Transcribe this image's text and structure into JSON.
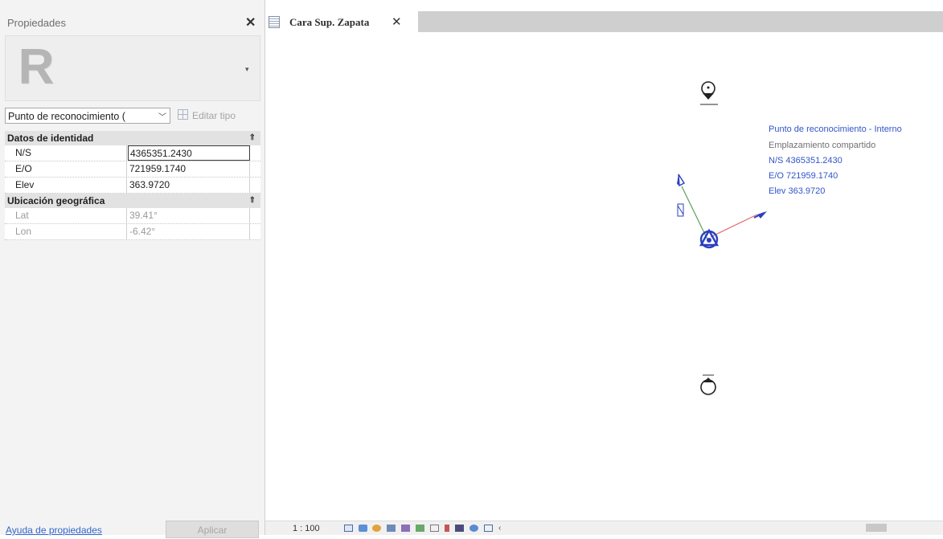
{
  "properties_panel": {
    "title": "Propiedades",
    "close_icon": "close-icon",
    "logo_letter": "R",
    "type_selector": "Punto de reconocimiento (",
    "edit_type_label": "Editar tipo",
    "groups": [
      {
        "name": "Datos de identidad",
        "rows": [
          {
            "name": "N/S",
            "value": "4365351.2430"
          },
          {
            "name": "E/O",
            "value": "721959.1740"
          },
          {
            "name": "Elev",
            "value": "363.9720"
          }
        ]
      },
      {
        "name": "Ubicación geográfica",
        "rows": [
          {
            "name": "Lat",
            "value": "39.41°"
          },
          {
            "name": "Lon",
            "value": "-6.42°"
          }
        ]
      }
    ],
    "help_link": "Ayuda de propiedades",
    "apply_button": "Aplicar"
  },
  "view_tab": {
    "label": "Cara Sup. Zapata",
    "icon": "floor-plan-view-icon",
    "close_icon": "close-icon"
  },
  "canvas": {
    "annotation": {
      "title": "Punto de reconocimiento - Interno",
      "subtitle": "Emplazamiento compartido",
      "ns": "N/S  4365351.2430",
      "eo": "E/O  721959.1740",
      "elev": "Elev  363.9720"
    },
    "north_axis_label": "N",
    "colors": {
      "annotation_blue": "#3355c9",
      "survey_marker": "#2a3fc0",
      "east_axis": "#e06a6a",
      "north_axis": "#5aa05a"
    }
  },
  "status_bar": {
    "scale": "1 : 100"
  }
}
